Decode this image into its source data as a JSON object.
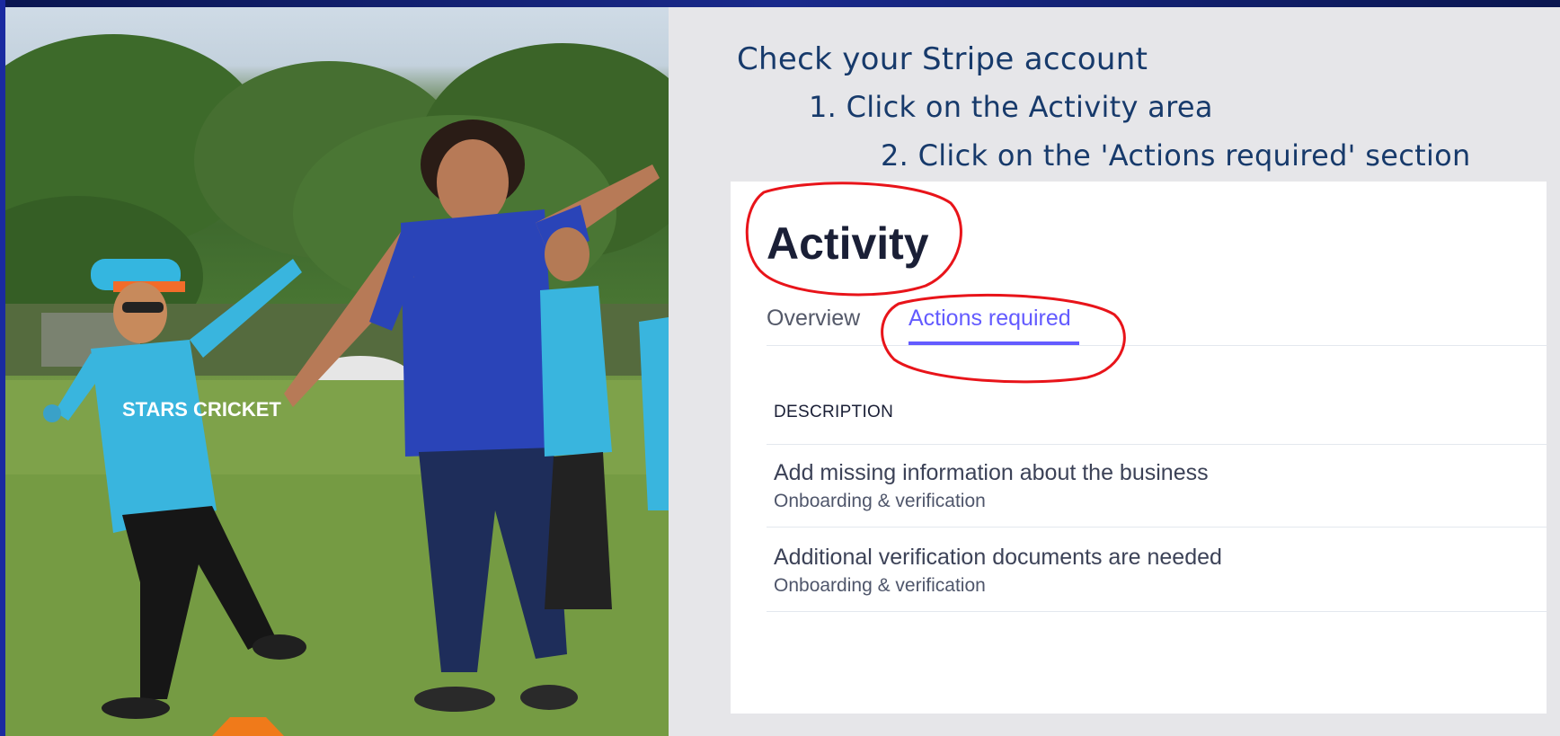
{
  "instructions": {
    "heading": "Check your Stripe account",
    "step1": "1. Click on the Activity area",
    "step2": "2. Click on the 'Actions required' section"
  },
  "screenshot": {
    "title": "Activity",
    "tabs": [
      {
        "label": "Overview",
        "active": false
      },
      {
        "label": "Actions required",
        "active": true
      }
    ],
    "table": {
      "column_header": "DESCRIPTION",
      "rows": [
        {
          "title": "Add missing information about the business",
          "subtitle": "Onboarding & verification"
        },
        {
          "title": "Additional verification documents are needed",
          "subtitle": "Onboarding & verification"
        }
      ]
    }
  },
  "photo": {
    "shirt_text": "STARS CRICKET"
  },
  "colors": {
    "accent": "#635bff",
    "annotation": "#e8141a",
    "instruction_text": "#173a6b",
    "frame": "#0c1a5c"
  }
}
